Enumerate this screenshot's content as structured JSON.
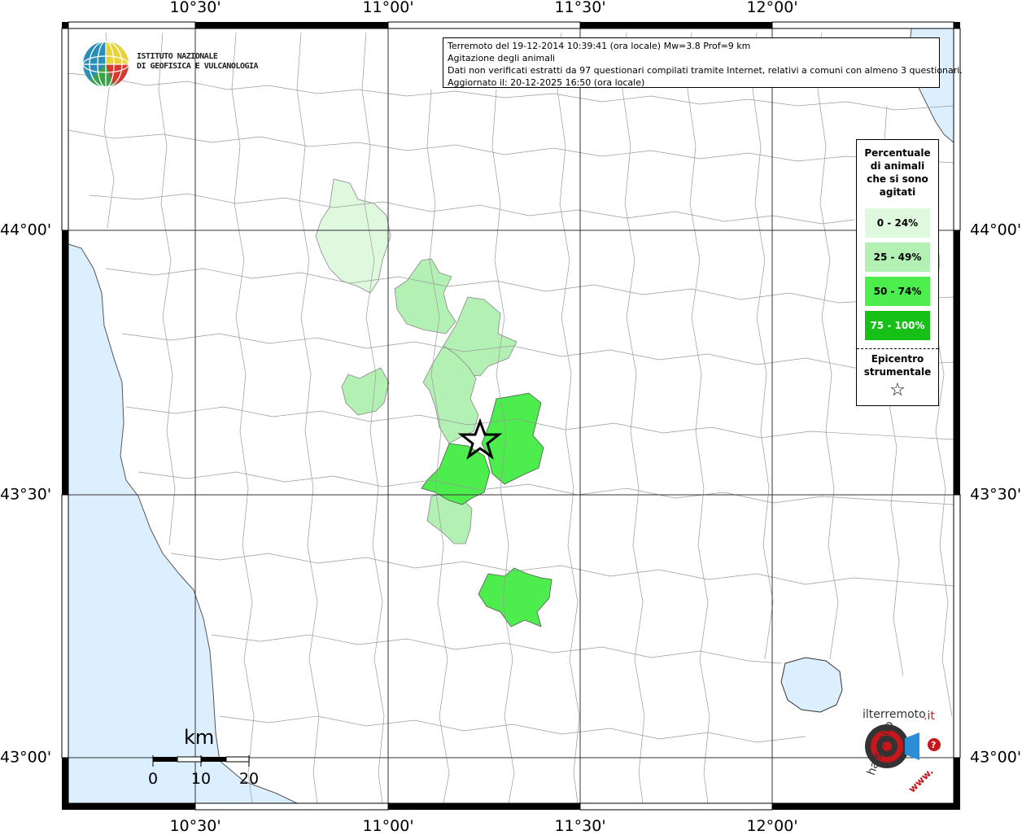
{
  "coords": {
    "lon_top": [
      "10°30'",
      "11°00'",
      "11°30'",
      "12°00'"
    ],
    "lon_bottom": [
      "10°30'",
      "11°00'",
      "11°30'",
      "12°00'"
    ],
    "lat_left": [
      "44°00'",
      "43°30'",
      "43°00'"
    ],
    "lat_right": [
      "44°00'",
      "43°30'",
      "43°00'"
    ]
  },
  "logo": {
    "line1": "ISTITUTO NAZIONALE",
    "line2": "DI GEOFISICA E VULCANOLOGIA"
  },
  "info": {
    "line1": "Terremoto del 19-12-2014 10:39:41 (ora locale) Mw=3.8 Prof=9 km",
    "line2": "Agitazione degli animali",
    "line3": "Dati non verificati estratti da 97 questionari compilati tramite Internet, relativi a comuni con almeno 3 questionari.",
    "line4": "Aggiornato il: 20-12-2025 16:50 (ora locale)"
  },
  "legend": {
    "title_1": "Percentuale",
    "title_2": "di animali",
    "title_3": "che si sono",
    "title_4": "agitati",
    "classes": [
      {
        "label": "0 - 24%",
        "color": "#dff9df",
        "text_color": "#000000"
      },
      {
        "label": "25 - 49%",
        "color": "#b3f0b3",
        "text_color": "#000000"
      },
      {
        "label": "50 - 74%",
        "color": "#4ded4d",
        "text_color": "#000000"
      },
      {
        "label": "75 - 100%",
        "color": "#17c017",
        "text_color": "#ffffff"
      }
    ],
    "epicenter_1": "Epicentro",
    "epicenter_2": "strumentale",
    "epicenter_symbol": "☆"
  },
  "scale": {
    "unit": "km",
    "labels": [
      "0",
      "10",
      "20"
    ]
  },
  "watermark": {
    "text_left": "haisentito",
    "text_mid": "ilterremoto",
    "text_suffix": ".it",
    "text_bottom": "www.",
    "text_q": "?"
  },
  "colors": {
    "sea": "#dcefff",
    "class_0": "#dff9df",
    "class_1": "#b3f0b3",
    "class_2": "#4ded4d",
    "class_3": "#17c017"
  }
}
